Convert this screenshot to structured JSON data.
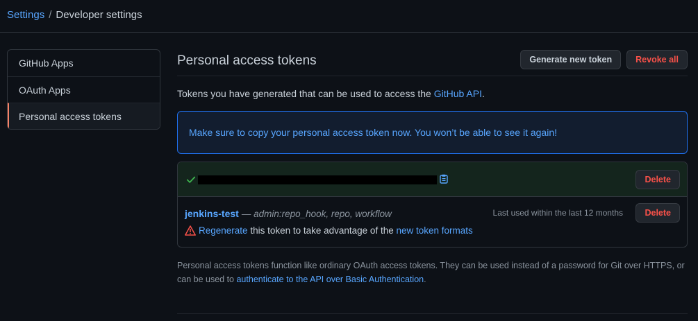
{
  "breadcrumb": {
    "root": "Settings",
    "separator": "/",
    "current": "Developer settings"
  },
  "sidebar": {
    "items": [
      {
        "label": "GitHub Apps"
      },
      {
        "label": "OAuth Apps"
      },
      {
        "label": "Personal access tokens",
        "selected": true
      }
    ]
  },
  "main": {
    "title": "Personal access tokens",
    "generate_label": "Generate new token",
    "revoke_label": "Revoke all",
    "intro_prefix": "Tokens you have generated that can be used to access the ",
    "intro_link": "GitHub API",
    "intro_suffix": ".",
    "flash": "Make sure to copy your personal access token now. You won’t be able to see it again!",
    "tokens": {
      "new_token": {
        "delete_label": "Delete"
      },
      "existing": {
        "name": "jenkins-test",
        "scopes": "— admin:repo_hook, repo, workflow",
        "last_used": "Last used within the last 12 months",
        "delete_label": "Delete",
        "regen_link": "Regenerate",
        "regen_middle": " this token to take advantage of the ",
        "regen_link2": "new token formats"
      }
    },
    "note_prefix": "Personal access tokens function like ordinary OAuth access tokens. They can be used instead of a password for Git over HTTPS, or can be used to ",
    "note_link": "authenticate to the API over Basic Authentication",
    "note_suffix": "."
  },
  "colors": {
    "background": "#0d1117",
    "link": "#58a6ff",
    "danger": "#f85149",
    "success": "#3fb950",
    "warning": "#f85149",
    "selected_marker": "#f78166"
  },
  "icons": {
    "check": "check-icon",
    "clipboard": "clipboard-icon",
    "warning": "alert-icon"
  }
}
